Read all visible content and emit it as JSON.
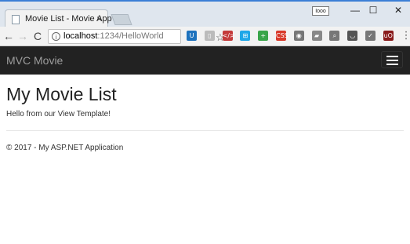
{
  "browser": {
    "tab_title": "Movie List - Movie App",
    "tab_close": "×",
    "user_badge": "Iooo",
    "window_controls": {
      "minimize": "—",
      "maximize": "☐",
      "close": "✕"
    },
    "nav": {
      "back": "←",
      "forward": "→",
      "reload": "C"
    },
    "url_host": "localhost",
    "url_path": ":1234/HelloWorld",
    "star": "☆",
    "extensions": [
      {
        "name": "password-manager-icon",
        "glyph": "U",
        "color": "#1e72bd"
      },
      {
        "name": "document-icon",
        "glyph": "▯",
        "color": "#bbbbbb"
      },
      {
        "name": "code-icon",
        "glyph": "</>",
        "color": "#c43b3b"
      },
      {
        "name": "windows-icon",
        "glyph": "⊞",
        "color": "#1ea7e8"
      },
      {
        "name": "plus-extension-icon",
        "glyph": "+",
        "color": "#3aa54a"
      },
      {
        "name": "css-icon",
        "glyph": "CSS",
        "color": "#d93a2a"
      },
      {
        "name": "rss-icon",
        "glyph": "◉",
        "color": "#777777"
      },
      {
        "name": "folder-icon",
        "glyph": "▰",
        "color": "#888888"
      },
      {
        "name": "magnifier-icon",
        "glyph": "⌕",
        "color": "#777777"
      },
      {
        "name": "pocket-icon",
        "glyph": "◡",
        "color": "#555555"
      },
      {
        "name": "check-box-icon",
        "glyph": "✓",
        "color": "#777777"
      },
      {
        "name": "ublock-icon",
        "glyph": "uO",
        "color": "#8a1c1c"
      },
      {
        "name": "menu-dots-icon",
        "glyph": "⋮",
        "color": "#f2f2f2"
      }
    ]
  },
  "navbar": {
    "brand": "MVC Movie"
  },
  "main": {
    "title": "My Movie List",
    "greeting": "Hello from our View Template!"
  },
  "footer": {
    "text": "© 2017 - My ASP.NET Application"
  }
}
